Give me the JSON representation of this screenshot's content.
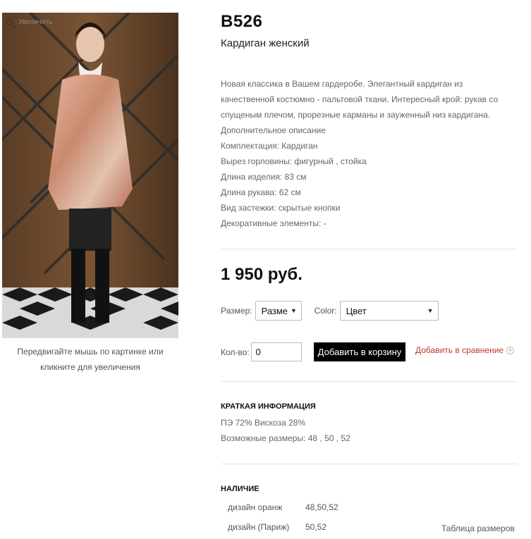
{
  "image": {
    "zoom_label": "Увеличить",
    "caption": "Передвигайте мышь по картинке или кликните для увеличения"
  },
  "product": {
    "sku": "B526",
    "subtitle": "Кардиган женский",
    "description": [
      "Новая классика в Вашем гардеробе. Элегантный кардиган из",
      "качественной костюмно - пальтовой ткани. Интересный крой: рукав со",
      "спущеным плечом, прорезные карманы и зауженный низ кардигана.",
      "Дополнительное описание",
      "Комплектация: Кардиган",
      "Вырез горловины: фигурный , стойка",
      "Длина изделия: 83 см",
      "Длина рукава: 62 см",
      "Вид застежки: скрытые кнопки",
      "Декоративные элементы: -"
    ],
    "price": "1 950 руб."
  },
  "options": {
    "size_label": "Размер:",
    "size_value": "Разме",
    "color_label": "Color:",
    "color_value": "Цвет"
  },
  "purchase": {
    "qty_label": "Кол-во:",
    "qty_value": "0",
    "add_to_cart": "Добавить в корзину",
    "add_to_compare": "Добавить в сравнение"
  },
  "brief": {
    "title": "КРАТКАЯ ИНФОРМАЦИЯ",
    "composition": "ПЭ 72% Вискоза 28%",
    "sizes": "Возможные размеры: 48 , 50 , 52"
  },
  "availability": {
    "title": "НАЛИЧИЕ",
    "rows": [
      {
        "name": "дизайн оранж",
        "sizes": "48,50,52"
      },
      {
        "name": "дизайн (Париж)",
        "sizes": "50,52"
      }
    ],
    "size_table_link": "Таблица размеров"
  },
  "colors": {
    "accent_red": "#c0392b",
    "button_black": "#000000"
  }
}
